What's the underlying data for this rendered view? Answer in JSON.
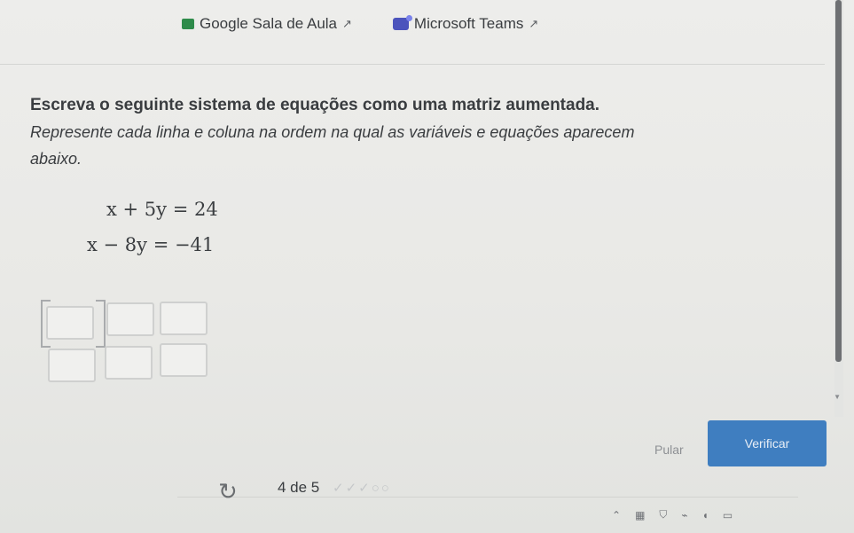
{
  "top_links": [
    {
      "label": "Google Sala de Aula",
      "icon": "google-classroom-icon",
      "ext_icon": "↗"
    },
    {
      "label": "Microsoft Teams",
      "icon": "microsoft-teams-icon",
      "ext_icon": "↗"
    }
  ],
  "problem": {
    "heading": "Escreva o seguinte sistema de equações como uma matriz aumentada.",
    "instruction": "Represente cada linha e coluna na ordem na qual as variáveis e equações aparecem abaixo.",
    "equations": [
      "x + 5y = 24",
      "x − 8y = −41"
    ]
  },
  "matrix": {
    "rows": [
      [
        "",
        "",
        ""
      ],
      [
        "",
        "",
        ""
      ]
    ]
  },
  "actions": {
    "skip_label": "Pular",
    "verify_label": "Verificar"
  },
  "progress": {
    "text": "4 de 5",
    "marks": "✓✓✓○○"
  },
  "colors": {
    "accent": "#3f7ec0",
    "background": "#ececea",
    "text": "#3a3d40"
  }
}
